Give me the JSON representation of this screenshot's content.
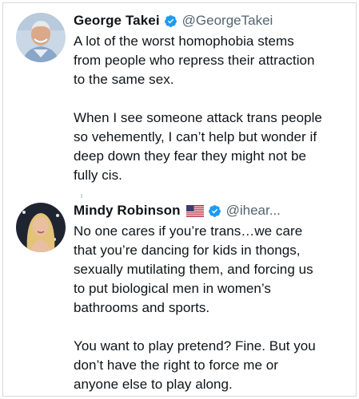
{
  "tweets": [
    {
      "name": "George Takei",
      "handle": "@GeorgeTakei",
      "verified": true,
      "text": "A lot of the worst homophobia stems\nfrom people who repress their attraction\nto the same sex.\n\nWhen I see someone attack trans people\nso vehemently, I can’t help but wonder if\ndeep down they fear they might not be\nfully cis."
    },
    {
      "name": "Mindy Robinson",
      "handle": "@ihear...",
      "verified": true,
      "flag_icon": "us-flag-icon",
      "text": "No one cares if you’re trans…we care\nthat you’re dancing for kids in thongs,\nsexually mutilating them, and forcing us\nto put biological men in women’s\nbathrooms and sports.\n\nYou want to play pretend? Fine. But you\ndon’t have the right to force me or\nanyone else to play along."
    }
  ],
  "colors": {
    "verified_badge": "#1d9bf0",
    "handle_text": "#536471",
    "thread_line": "#cfd9de"
  }
}
